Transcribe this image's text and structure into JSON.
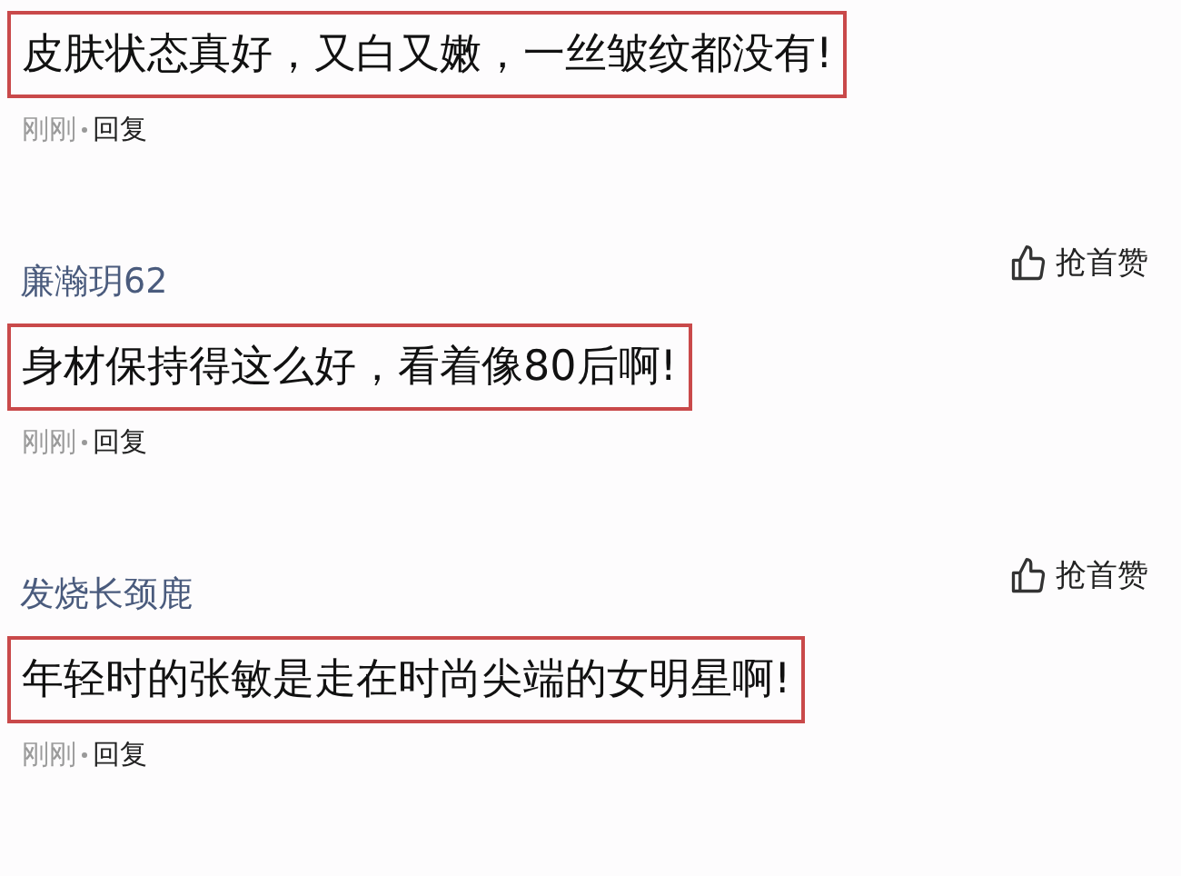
{
  "comments": [
    {
      "text": "皮肤状态真好，又白又嫩，一丝皱纹都没有!",
      "highlighted": true,
      "time": "刚刚",
      "reply": "回复"
    },
    {
      "author": "廉瀚玥62",
      "like": "抢首赞",
      "text": "身材保持得这么好，看着像80后啊!",
      "highlighted": true,
      "time": "刚刚",
      "reply": "回复"
    },
    {
      "author": "发烧长颈鹿",
      "like": "抢首赞",
      "text": "年轻时的张敏是走在时尚尖端的女明星啊!",
      "highlighted": true,
      "time": "刚刚",
      "reply": "回复"
    }
  ]
}
